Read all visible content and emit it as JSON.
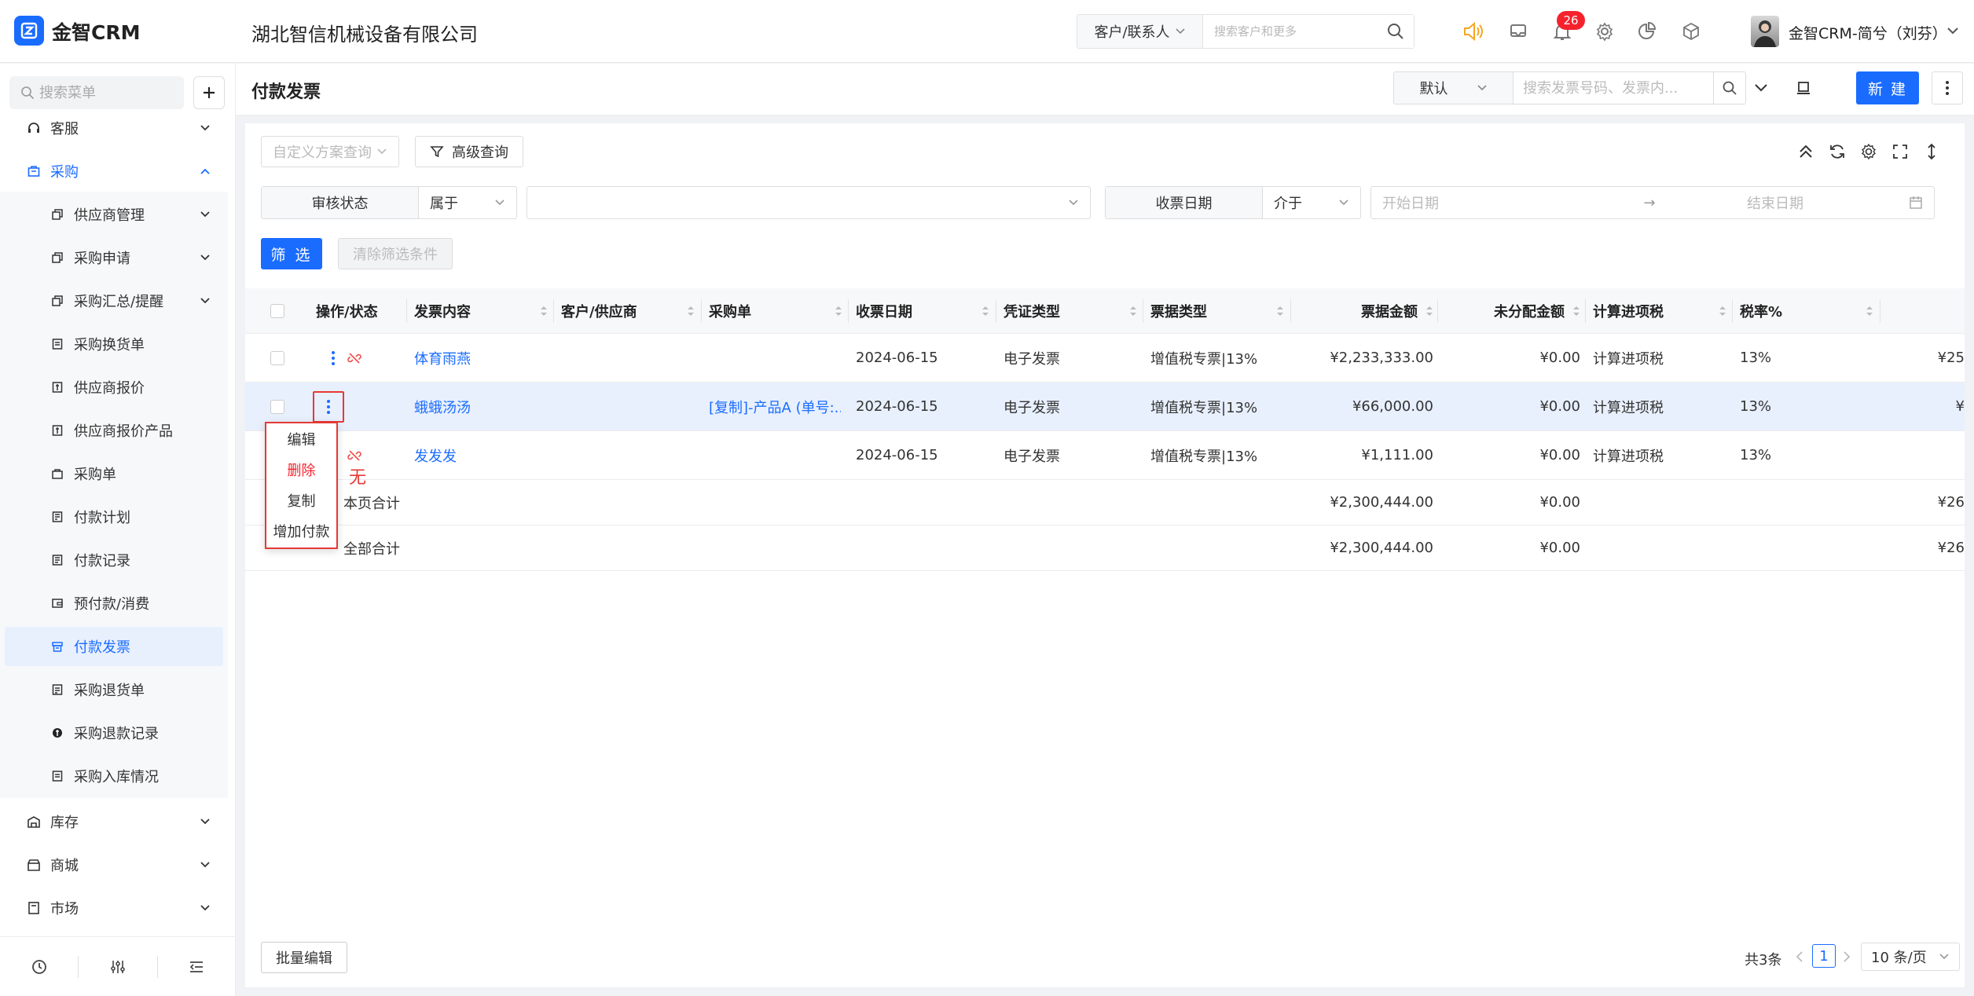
{
  "app": {
    "brand": "金智CRM",
    "company": "湖北智信机械设备有限公司",
    "search_type": "客户/联系人",
    "search_placeholder": "搜索客户和更多",
    "notification_count": "26",
    "user_name": "金智CRM-简兮（刘芬）",
    "accent_color": "#1a6cff"
  },
  "sidebar": {
    "search_placeholder": "搜索菜单",
    "items": [
      {
        "label": "客服",
        "icon": "headset-icon"
      },
      {
        "label": "采购",
        "icon": "bag-icon"
      },
      {
        "label": "供应商管理",
        "icon": "copy-icon"
      },
      {
        "label": "采购申请",
        "icon": "copy-icon"
      },
      {
        "label": "采购汇总/提醒",
        "icon": "copy-icon"
      },
      {
        "label": "采购换货单",
        "icon": "exchange-doc-icon"
      },
      {
        "label": "供应商报价",
        "icon": "quote-doc-icon"
      },
      {
        "label": "供应商报价产品",
        "icon": "quote-doc-icon"
      },
      {
        "label": "采购单",
        "icon": "bag-icon"
      },
      {
        "label": "付款计划",
        "icon": "plan-doc-icon"
      },
      {
        "label": "付款记录",
        "icon": "record-doc-icon"
      },
      {
        "label": "预付款/消费",
        "icon": "wallet-icon"
      },
      {
        "label": "付款发票",
        "icon": "invoice-icon"
      },
      {
        "label": "采购退货单",
        "icon": "return-doc-icon"
      },
      {
        "label": "采购退款记录",
        "icon": "refund-icon"
      },
      {
        "label": "采购入库情况",
        "icon": "stock-doc-icon"
      },
      {
        "label": "库存",
        "icon": "warehouse-icon"
      },
      {
        "label": "商城",
        "icon": "shop-icon"
      },
      {
        "label": "市场",
        "icon": "market-icon"
      }
    ]
  },
  "header": {
    "title": "付款发票",
    "view_select": "默认",
    "search_placeholder": "搜索发票号码、发票内...",
    "new_label": "新 建"
  },
  "toolbar": {
    "custom_query": "自定义方案查询",
    "advanced_query": "高级查询"
  },
  "filters": {
    "status_label": "审核状态",
    "status_op": "属于",
    "date_label": "收票日期",
    "date_op": "介于",
    "start_placeholder": "开始日期",
    "end_placeholder": "结束日期",
    "arrow": "→",
    "filter_label": "筛 选",
    "clear_label": "清除筛选条件"
  },
  "table": {
    "columns": [
      "操作/状态",
      "发票内容",
      "客户/供应商",
      "采购单",
      "收票日期",
      "凭证类型",
      "票据类型",
      "票据金额",
      "未分配金额",
      "计算进项税",
      "税率%"
    ],
    "rows": [
      {
        "content": "体育雨燕",
        "supplier": "",
        "order": "",
        "date": "2024-06-15",
        "voucher": "电子发票",
        "bill_type": "增值税专票|13%",
        "amount": "¥2,233,333.00",
        "unassigned": "¥0.00",
        "tax_calc": "计算进项税",
        "rate": "13%",
        "overflow": "¥25"
      },
      {
        "content": "蛾蛾汤汤",
        "supplier": "",
        "order": "[复制]-产品A (单号:...",
        "date": "2024-06-15",
        "voucher": "电子发票",
        "bill_type": "增值税专票|13%",
        "amount": "¥66,000.00",
        "unassigned": "¥0.00",
        "tax_calc": "计算进项税",
        "rate": "13%",
        "overflow": "¥"
      },
      {
        "content": "发发发",
        "supplier": "",
        "order": "",
        "date": "2024-06-15",
        "voucher": "电子发票",
        "bill_type": "增值税专票|13%",
        "amount": "¥1,111.00",
        "unassigned": "¥0.00",
        "tax_calc": "计算进项税",
        "rate": "13%",
        "overflow": ""
      }
    ],
    "page_total": {
      "label": "本页合计",
      "amount": "¥2,300,444.00",
      "unassigned": "¥0.00",
      "overflow": "¥26"
    },
    "grand_total": {
      "label": "全部合计",
      "amount": "¥2,300,444.00",
      "unassigned": "¥0.00",
      "overflow": "¥26"
    }
  },
  "row_menu": {
    "items": [
      "编辑",
      "删除",
      "复制",
      "增加付款"
    ],
    "annotation": "无"
  },
  "footer": {
    "bulk_edit": "批量编辑",
    "total_text": "共3条",
    "current_page": "1",
    "page_size": "10 条/页"
  }
}
